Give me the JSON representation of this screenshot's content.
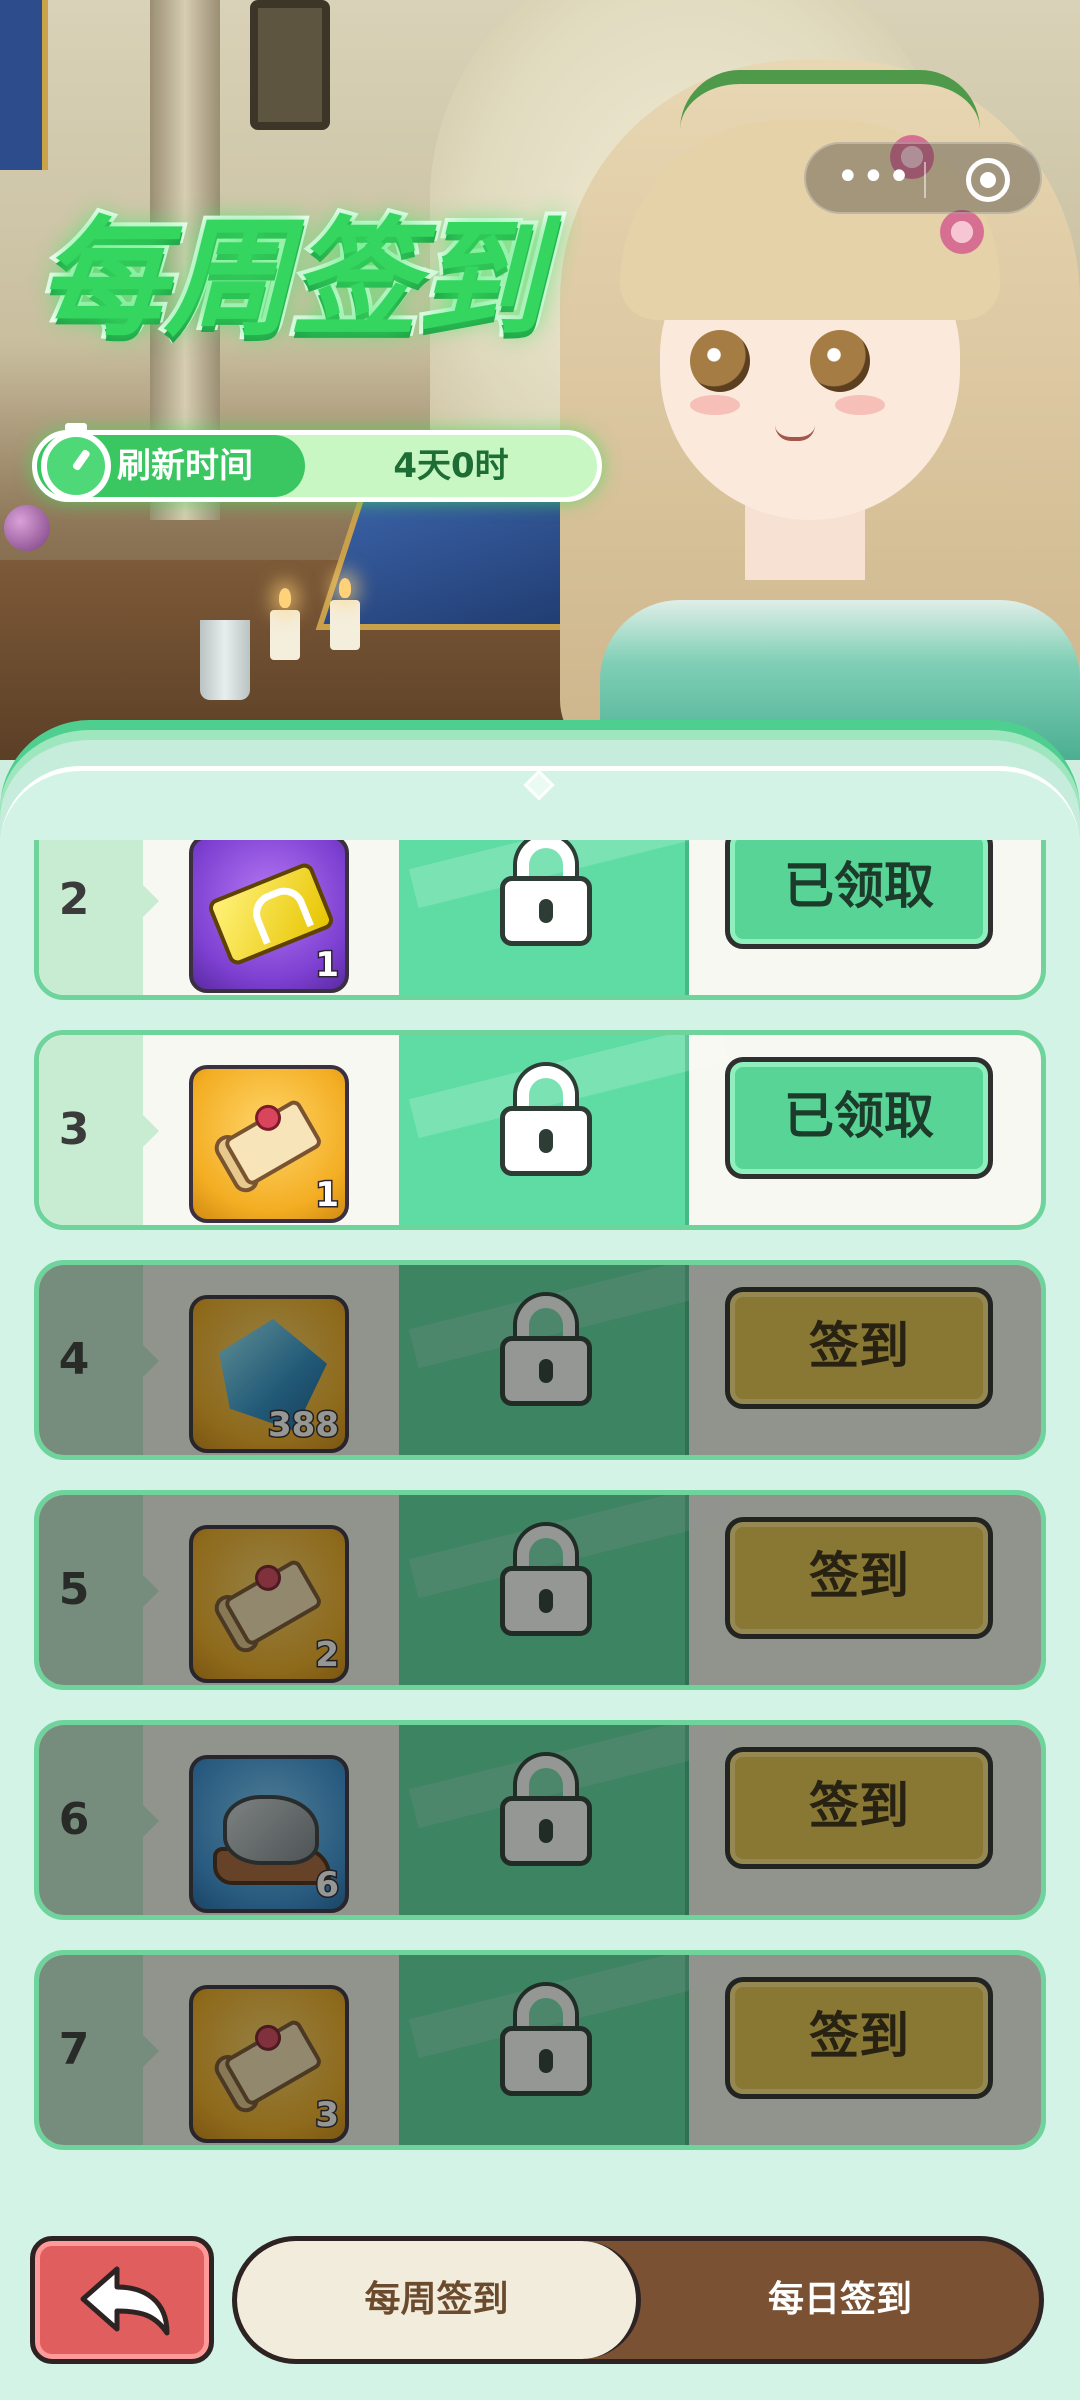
{
  "header": {
    "title": "每周签到",
    "refresh_label": "刷新时间",
    "refresh_value": "4天0时"
  },
  "capsule": {
    "more_dots": "•••"
  },
  "rewards": [
    {
      "day": "2",
      "icon": "gold-ticket-icon",
      "qty": "1",
      "status": "已领取",
      "state": "claimed"
    },
    {
      "day": "3",
      "icon": "scroll-icon",
      "qty": "1",
      "status": "已领取",
      "state": "claimed"
    },
    {
      "day": "4",
      "icon": "blue-crystal-icon",
      "qty": "388",
      "status": "签到",
      "state": "locked"
    },
    {
      "day": "5",
      "icon": "scroll-icon",
      "qty": "2",
      "status": "签到",
      "state": "locked"
    },
    {
      "day": "6",
      "icon": "ore-icon",
      "qty": "6",
      "status": "签到",
      "state": "locked"
    },
    {
      "day": "7",
      "icon": "scroll-icon",
      "qty": "3",
      "status": "签到",
      "state": "locked"
    }
  ],
  "tabs": {
    "weekly": "每周签到",
    "daily": "每日签到"
  },
  "colors": {
    "accent_green": "#34d65f",
    "claimed_button": "#58d497",
    "sign_button": "#e7c74f",
    "back_button": "#e05e5e",
    "tab_bar": "#7a5132"
  }
}
